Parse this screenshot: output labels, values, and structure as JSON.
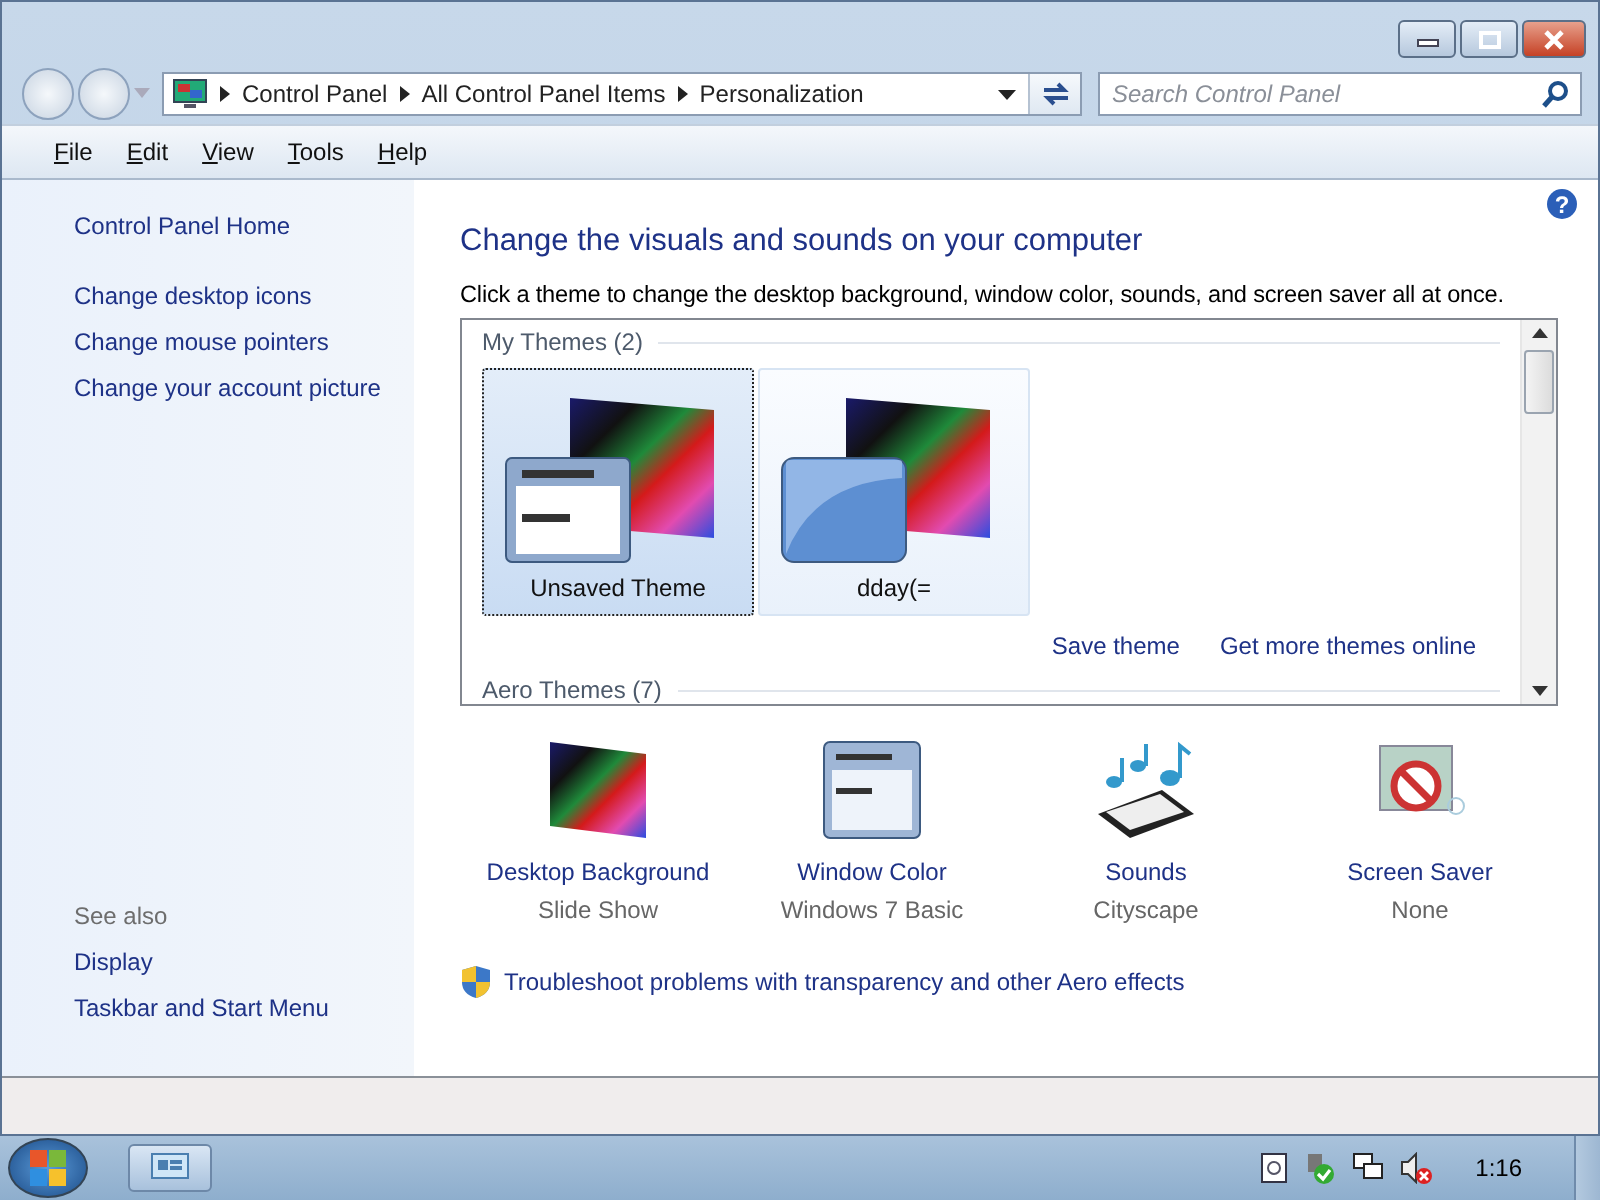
{
  "address_bar": {
    "breadcrumbs": [
      "Control Panel",
      "All Control Panel Items",
      "Personalization"
    ],
    "search_placeholder": "Search Control Panel"
  },
  "menu": [
    "File",
    "Edit",
    "View",
    "Tools",
    "Help"
  ],
  "sidebar": {
    "home": "Control Panel Home",
    "links": [
      "Change desktop icons",
      "Change mouse pointers",
      "Change your account picture"
    ],
    "see_also_heading": "See also",
    "see_also_links": [
      "Display",
      "Taskbar and Start Menu"
    ]
  },
  "main": {
    "heading": "Change the visuals and sounds on your computer",
    "description": "Click a theme to change the desktop background, window color, sounds, and screen saver all at once.",
    "theme_groups": [
      {
        "title": "My Themes (2)",
        "themes": [
          {
            "name": "Unsaved Theme",
            "kind": "basic",
            "selected": true
          },
          {
            "name": "dday(=",
            "kind": "glass",
            "selected": false
          }
        ],
        "actions": [
          "Save theme",
          "Get more themes online"
        ]
      },
      {
        "title": "Aero Themes (7)"
      }
    ],
    "help_glyph": "?",
    "settings": [
      {
        "kind": "background",
        "label": "Desktop Background",
        "value": "Slide Show"
      },
      {
        "kind": "color",
        "label": "Window Color",
        "value": "Windows 7 Basic"
      },
      {
        "kind": "sounds",
        "label": "Sounds",
        "value": "Cityscape"
      },
      {
        "kind": "screensaver",
        "label": "Screen Saver",
        "value": "None"
      }
    ],
    "troubleshoot_link": "Troubleshoot problems with transparency and other Aero effects"
  },
  "taskbar": {
    "clock": "1:16"
  }
}
